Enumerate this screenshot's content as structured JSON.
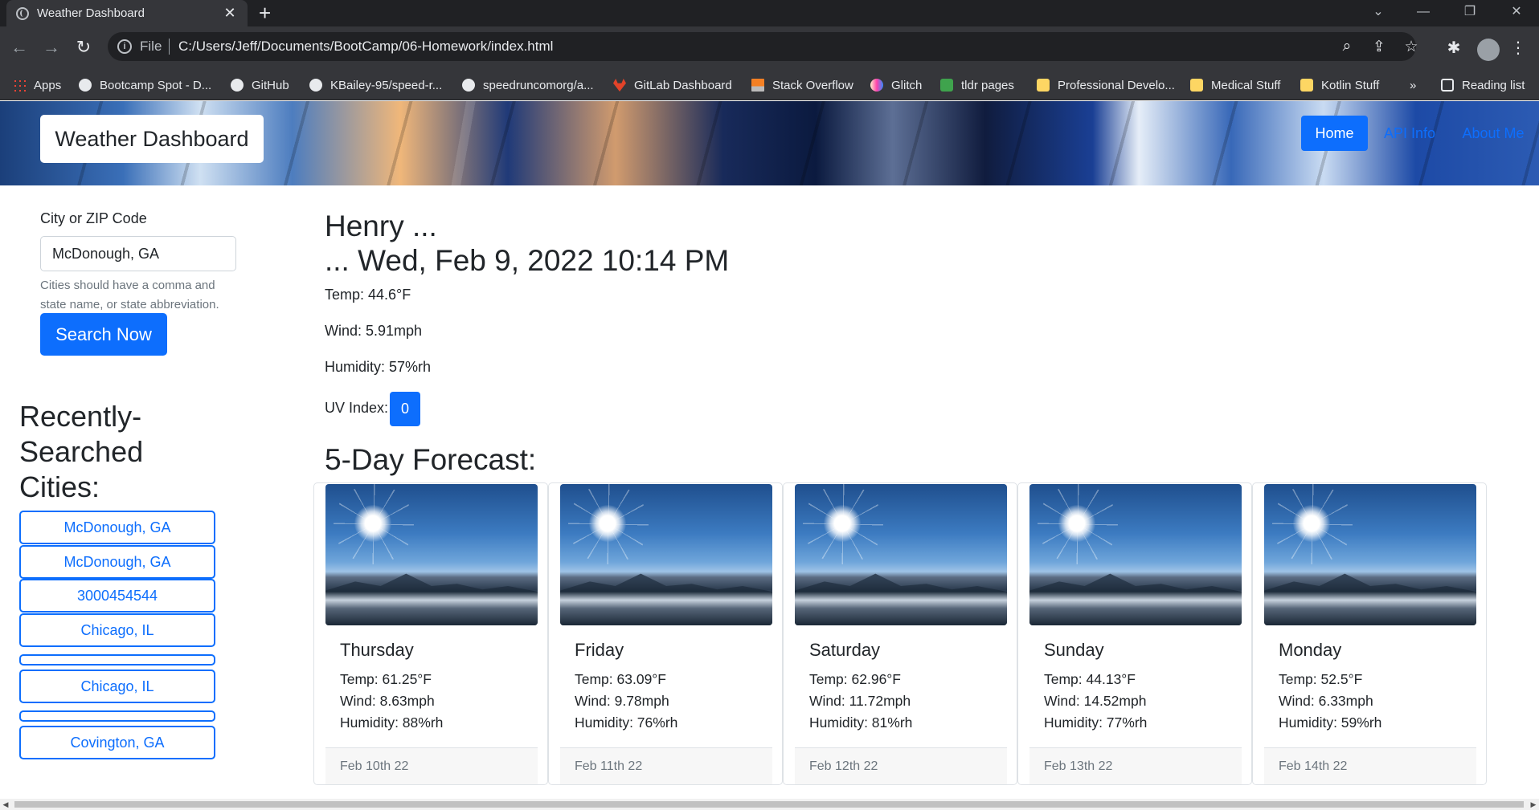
{
  "browser": {
    "tab_title": "Weather Dashboard",
    "url_scheme": "File",
    "url": "C:/Users/Jeff/Documents/BootCamp/06-Homework/index.html",
    "bookmarks": [
      {
        "label": "Apps",
        "icon": "apps-grid-icon"
      },
      {
        "label": "Bootcamp Spot - D...",
        "icon": "globe-icon"
      },
      {
        "label": "GitHub",
        "icon": "github-icon"
      },
      {
        "label": "KBailey-95/speed-r...",
        "icon": "github-icon"
      },
      {
        "label": "speedruncomorg/a...",
        "icon": "github-icon"
      },
      {
        "label": "GitLab Dashboard",
        "icon": "gitlab-icon"
      },
      {
        "label": "Stack Overflow",
        "icon": "stackoverflow-icon"
      },
      {
        "label": "Glitch",
        "icon": "glitch-icon"
      },
      {
        "label": "tldr pages",
        "icon": "tldr-icon"
      },
      {
        "label": "Professional Develo...",
        "icon": "folder-icon"
      },
      {
        "label": "Medical Stuff",
        "icon": "folder-icon"
      },
      {
        "label": "Kotlin Stuff",
        "icon": "folder-icon"
      }
    ],
    "overflow_label": "»",
    "reading_list": "Reading list"
  },
  "header": {
    "brand": "Weather Dashboard",
    "nav": [
      "Home",
      "API Info",
      "About Me"
    ]
  },
  "search": {
    "label": "City or ZIP Code",
    "value": "McDonough, GA",
    "help": "Cities should have a comma and state name, or state abbreviation.",
    "button": "Search Now"
  },
  "history": {
    "heading_lines": [
      "Recently-",
      "Searched",
      "Cities:"
    ],
    "items": [
      "McDonough, GA",
      "McDonough, GA",
      "3000454544",
      "Chicago, IL",
      "",
      "Chicago, IL",
      "",
      "Covington, GA"
    ]
  },
  "current": {
    "title_line1": "Henry ...",
    "title_line2": "... Wed, Feb 9, 2022 10:14 PM",
    "temp": "Temp: 44.6°F",
    "wind": "Wind: 5.91mph",
    "humidity": "Humidity: 57%rh",
    "uv_label": "UV Index:",
    "uv_value": "0"
  },
  "forecast": {
    "heading": "5-Day Forecast:",
    "days": [
      {
        "day": "Thursday",
        "temp": "Temp: 61.25°F",
        "wind": "Wind: 8.63mph",
        "humidity": "Humidity: 88%rh",
        "date": "Feb 10th 22"
      },
      {
        "day": "Friday",
        "temp": "Temp: 63.09°F",
        "wind": "Wind: 9.78mph",
        "humidity": "Humidity: 76%rh",
        "date": "Feb 11th 22"
      },
      {
        "day": "Saturday",
        "temp": "Temp: 62.96°F",
        "wind": "Wind: 11.72mph",
        "humidity": "Humidity: 81%rh",
        "date": "Feb 12th 22"
      },
      {
        "day": "Sunday",
        "temp": "Temp: 44.13°F",
        "wind": "Wind: 14.52mph",
        "humidity": "Humidity: 77%rh",
        "date": "Feb 13th 22"
      },
      {
        "day": "Monday",
        "temp": "Temp: 52.5°F",
        "wind": "Wind: 6.33mph",
        "humidity": "Humidity: 59%rh",
        "date": "Feb 14th 22"
      }
    ]
  },
  "colors": {
    "primary": "#0d6efd",
    "chrome_dark": "#202124",
    "chrome_mid": "#35363a"
  }
}
